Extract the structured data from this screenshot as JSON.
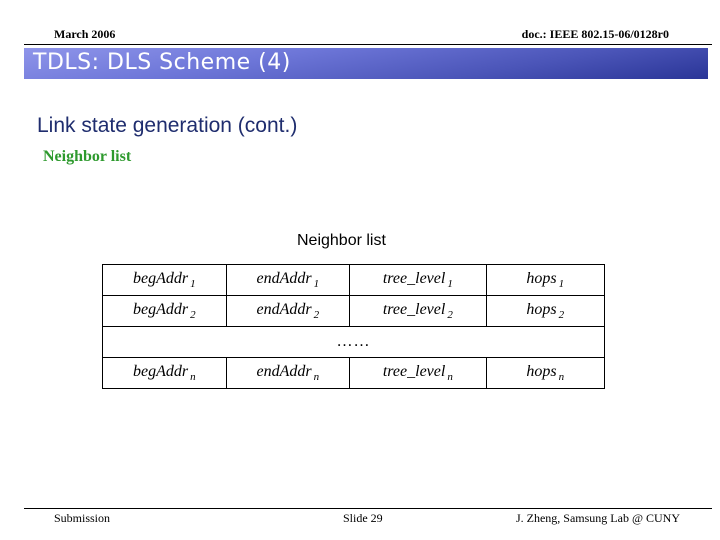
{
  "header": {
    "date": "March 2006",
    "doc_id": "doc.: IEEE 802.15-06/0128r0"
  },
  "banner": {
    "title": "TDLS: DLS Scheme (4)"
  },
  "body": {
    "subtitle": "Link state generation (cont.)",
    "section_heading": "Neighbor list"
  },
  "table": {
    "caption": "Neighbor list",
    "rows": [
      {
        "cells": [
          {
            "base": "begAddr",
            "sub": "1"
          },
          {
            "base": "endAddr",
            "sub": "1"
          },
          {
            "base": "tree_level",
            "sub": "1"
          },
          {
            "base": "hops",
            "sub": "1"
          }
        ]
      },
      {
        "cells": [
          {
            "base": "begAddr",
            "sub": "2"
          },
          {
            "base": "endAddr",
            "sub": "2"
          },
          {
            "base": "tree_level",
            "sub": "2"
          },
          {
            "base": "hops",
            "sub": "2"
          }
        ]
      },
      {
        "ellipsis": "……"
      },
      {
        "cells": [
          {
            "base": "begAddr",
            "sub": "n"
          },
          {
            "base": "endAddr",
            "sub": "n"
          },
          {
            "base": "tree_level",
            "sub": "n"
          },
          {
            "base": "hops",
            "sub": "n"
          }
        ]
      }
    ]
  },
  "footer": {
    "left": "Submission",
    "center": "Slide 29",
    "right": "J. Zheng, Samsung Lab @ CUNY"
  },
  "colors": {
    "subtitle": "#1f2d6e",
    "section_heading": "#2e9a2e",
    "banner_light": "#8f95ea",
    "banner_dark": "#2a3597"
  }
}
